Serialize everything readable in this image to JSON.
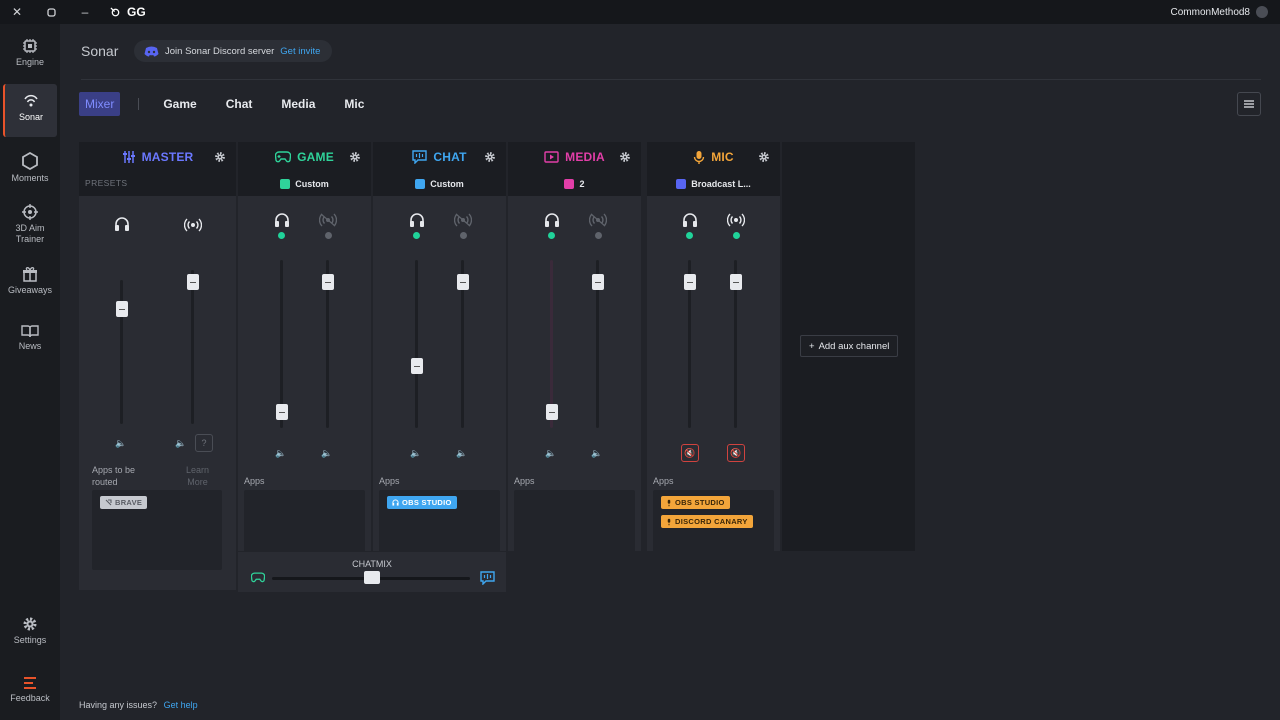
{
  "titlebar": {
    "brand": "GG",
    "username": "CommonMethod8"
  },
  "sidebar": {
    "items": [
      {
        "label": "Engine"
      },
      {
        "label": "Sonar"
      },
      {
        "label": "Moments"
      },
      {
        "label": "3D Aim Trainer"
      },
      {
        "label": "Giveaways"
      },
      {
        "label": "News"
      },
      {
        "label": "Settings"
      },
      {
        "label": "Feedback"
      }
    ]
  },
  "header": {
    "title": "Sonar",
    "discord_text": "Join Sonar Discord server",
    "discord_link": "Get invite"
  },
  "tabs": {
    "mixer": "Mixer",
    "game": "Game",
    "chat": "Chat",
    "media": "Media",
    "mic": "Mic"
  },
  "colors": {
    "master": "#6b78ff",
    "game": "#2fd39a",
    "chat": "#3fa6f0",
    "media": "#e23ea8",
    "mic": "#f3a53a",
    "live_dot": "#20d39a",
    "accent_orange": "#e8532a"
  },
  "channels": {
    "master": {
      "name": "MASTER",
      "presets_label": "PRESETS",
      "apps_label": "Apps to be routed",
      "learn_more": "Learn More",
      "apps": [
        "BRAVE"
      ],
      "headphone_level": 0.75,
      "stream_level": 0.95
    },
    "game": {
      "name": "GAME",
      "preset": "Custom",
      "apps_label": "Apps",
      "apps": [],
      "headphone_level": 0.1,
      "stream_level": 1.0
    },
    "chat": {
      "name": "CHAT",
      "preset": "Custom",
      "apps_label": "Apps",
      "apps": [
        "OBS STUDIO"
      ],
      "headphone_level": 0.45,
      "stream_level": 1.0
    },
    "media": {
      "name": "MEDIA",
      "preset": "2",
      "apps_label": "Apps",
      "apps": [],
      "headphone_level": 0.1,
      "stream_level": 1.0
    },
    "mic": {
      "name": "MIC",
      "preset": "Broadcast L...",
      "apps_label": "Apps",
      "apps": [
        "OBS STUDIO",
        "DISCORD CANARY"
      ],
      "headphone_level": 1.0,
      "stream_level": 1.0,
      "muted": true
    }
  },
  "chatmix": {
    "label": "CHATMIX",
    "balance": 0.5
  },
  "aux": {
    "label": "Add aux channel"
  },
  "footer": {
    "issues_text": "Having any issues?",
    "help_link": "Get help"
  }
}
